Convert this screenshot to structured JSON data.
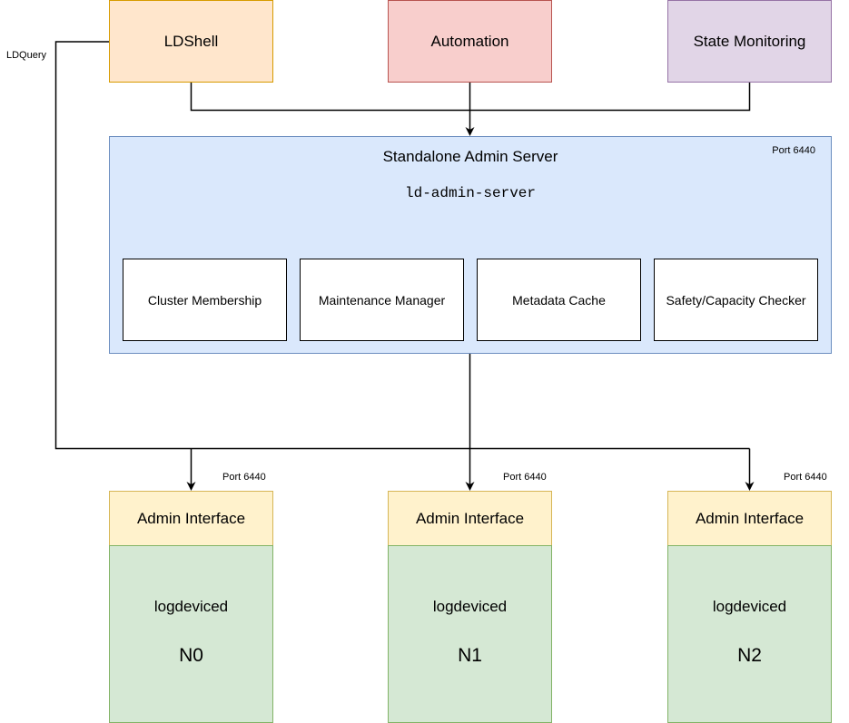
{
  "clients": [
    {
      "id": "ldshell",
      "label": "LDShell",
      "fill": "#ffe6cc",
      "stroke": "#d79b00"
    },
    {
      "id": "automation",
      "label": "Automation",
      "fill": "#f8cecc",
      "stroke": "#b85450"
    },
    {
      "id": "state-monitoring",
      "label": "State Monitoring",
      "fill": "#e1d5e7",
      "stroke": "#9673a6"
    }
  ],
  "server": {
    "title": "Standalone Admin Server",
    "binary": "ld-admin-server",
    "port": "Port 6440",
    "modules": [
      "Cluster Membership",
      "Maintenance Manager",
      "Metadata Cache",
      "Safety/Capacity Checker"
    ]
  },
  "edges": {
    "ldquery_label": "LDQuery"
  },
  "nodes": [
    {
      "interface": "Admin Interface",
      "process": "logdeviced",
      "id": "N0",
      "port": "Port 6440"
    },
    {
      "interface": "Admin Interface",
      "process": "logdeviced",
      "id": "N1",
      "port": "Port 6440"
    },
    {
      "interface": "Admin Interface",
      "process": "logdeviced",
      "id": "N2",
      "port": "Port 6440"
    }
  ]
}
